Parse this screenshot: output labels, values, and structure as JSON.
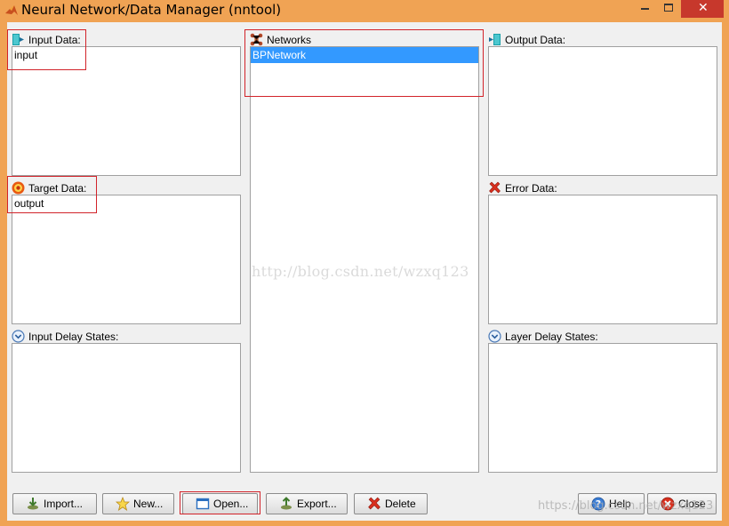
{
  "window": {
    "title": "Neural Network/Data Manager (nntool)"
  },
  "panels": {
    "input_data": {
      "label": "Input Data:",
      "items": [
        "input"
      ]
    },
    "target_data": {
      "label": "Target Data:",
      "items": [
        "output"
      ]
    },
    "input_delay_states": {
      "label": "Input Delay States:",
      "items": []
    },
    "networks": {
      "label": "Networks",
      "items": [
        "BPNetwork"
      ],
      "selected": "BPNetwork"
    },
    "output_data": {
      "label": "Output Data:",
      "items": []
    },
    "error_data": {
      "label": "Error Data:",
      "items": []
    },
    "layer_delay_states": {
      "label": "Layer Delay States:",
      "items": []
    }
  },
  "buttons": {
    "import": "Import...",
    "new": "New...",
    "open": "Open...",
    "export": "Export...",
    "delete": "Delete",
    "help": "Help",
    "close": "Close"
  },
  "watermarks": {
    "center": "http://blog.csdn.net/wzxq123",
    "corner": "https://blog.csdn.net/wzxq123"
  },
  "colors": {
    "frame": "#f0a354",
    "selection": "#3399ff",
    "highlight_box": "#d2232a",
    "close_button": "#c7382c"
  },
  "icons": {
    "input": "input-data-icon",
    "target": "target-icon",
    "delay": "chevron-down-circle-icon",
    "networks": "network-icon",
    "output": "output-data-icon",
    "error": "red-x-icon"
  }
}
